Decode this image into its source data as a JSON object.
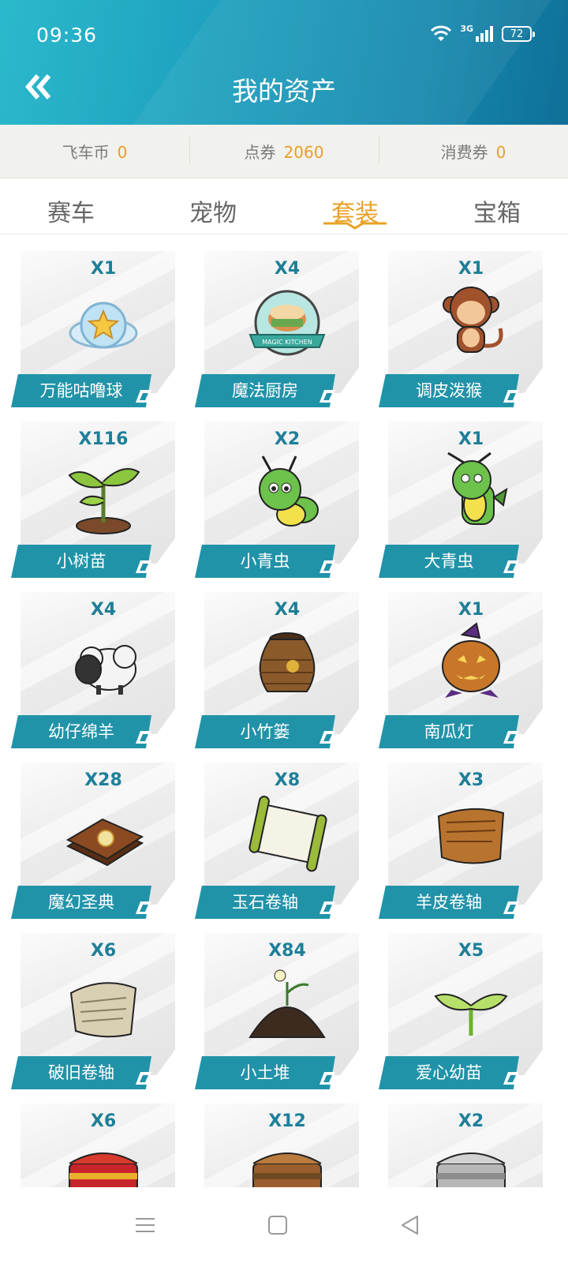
{
  "status_bar": {
    "time": "09:36",
    "network": "3G",
    "battery": "72"
  },
  "header": {
    "title": "我的资产"
  },
  "currencies": [
    {
      "label": "飞车币",
      "value": "0"
    },
    {
      "label": "点券",
      "value": "2060"
    },
    {
      "label": "消费券",
      "value": "0"
    }
  ],
  "tabs": [
    {
      "label": "赛车"
    },
    {
      "label": "宠物"
    },
    {
      "label": "套装",
      "active": true
    },
    {
      "label": "宝箱"
    }
  ],
  "items": [
    {
      "count": "X1",
      "name": "万能咕噜球",
      "icon": "star-ball-icon"
    },
    {
      "count": "X4",
      "name": "魔法厨房",
      "icon": "magic-kitchen-badge-icon",
      "art_text": "MAGIC KITCHEN"
    },
    {
      "count": "X1",
      "name": "调皮泼猴",
      "icon": "monkey-icon"
    },
    {
      "count": "X116",
      "name": "小树苗",
      "icon": "sapling-icon"
    },
    {
      "count": "X2",
      "name": "小青虫",
      "icon": "small-caterpillar-icon"
    },
    {
      "count": "X1",
      "name": "大青虫",
      "icon": "big-caterpillar-icon"
    },
    {
      "count": "X4",
      "name": "幼仔绵羊",
      "icon": "lamb-icon"
    },
    {
      "count": "X4",
      "name": "小竹篓",
      "icon": "bamboo-basket-icon"
    },
    {
      "count": "X1",
      "name": "南瓜灯",
      "icon": "pumpkin-lantern-icon"
    },
    {
      "count": "X28",
      "name": "魔幻圣典",
      "icon": "magic-book-icon"
    },
    {
      "count": "X8",
      "name": "玉石卷轴",
      "icon": "jade-scroll-icon"
    },
    {
      "count": "X3",
      "name": "羊皮卷轴",
      "icon": "parchment-scroll-icon"
    },
    {
      "count": "X6",
      "name": "破旧卷轴",
      "icon": "old-scroll-icon"
    },
    {
      "count": "X84",
      "name": "小土堆",
      "icon": "dirt-mound-icon"
    },
    {
      "count": "X5",
      "name": "爱心幼苗",
      "icon": "heart-sprout-icon"
    },
    {
      "count": "X6",
      "name": "",
      "icon": "red-chest-icon"
    },
    {
      "count": "X12",
      "name": "",
      "icon": "wooden-chest-icon"
    },
    {
      "count": "X2",
      "name": "",
      "icon": "silver-chest-icon"
    }
  ],
  "colors": {
    "header": "#1d9fbe",
    "accent": "#eaa024",
    "label_bg": "#2193a8",
    "count_text": "#1d7f99"
  }
}
